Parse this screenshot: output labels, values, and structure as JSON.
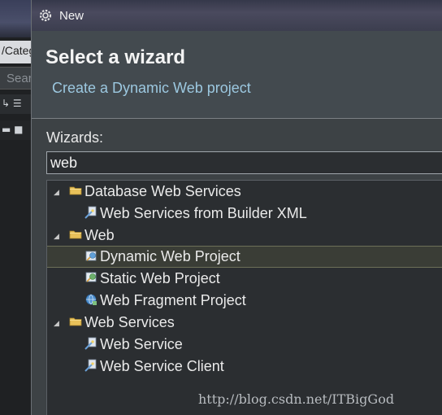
{
  "background_ide": {
    "tab_label": "/Categ",
    "search_placeholder": "Sear",
    "toolbar_glyphs": "↳ ☰",
    "toolbar2_glyphs": "▬ ■"
  },
  "window": {
    "title": "New",
    "icon": "gear-icon"
  },
  "header": {
    "title": "Select a wizard",
    "subtitle": "Create a Dynamic Web project"
  },
  "wizards": {
    "label": "Wizards:",
    "filter_value": "web",
    "tree": [
      {
        "label": "Database Web Services",
        "type": "folder",
        "expanded": true
      },
      {
        "label": "Web Services from Builder XML",
        "type": "wizard-icon"
      },
      {
        "label": "Web",
        "type": "folder",
        "expanded": true
      },
      {
        "label": "Dynamic Web Project",
        "type": "web-project-icon",
        "selected": true
      },
      {
        "label": "Static Web Project",
        "type": "web-project-icon"
      },
      {
        "label": "Web Fragment Project",
        "type": "globe-project-icon"
      },
      {
        "label": "Web Services",
        "type": "folder",
        "expanded": true
      },
      {
        "label": "Web Service",
        "type": "wizard-icon"
      },
      {
        "label": "Web Service Client",
        "type": "wizard-icon"
      }
    ]
  },
  "watermark": "http://blog.csdn.net/ITBigGod",
  "colors": {
    "dialog_bg": "#3d4245",
    "header_bg": "#434a4f",
    "subtitle": "#9cc8e0",
    "selection_bg": "#3a3d36",
    "folder": "#e8c15a"
  }
}
